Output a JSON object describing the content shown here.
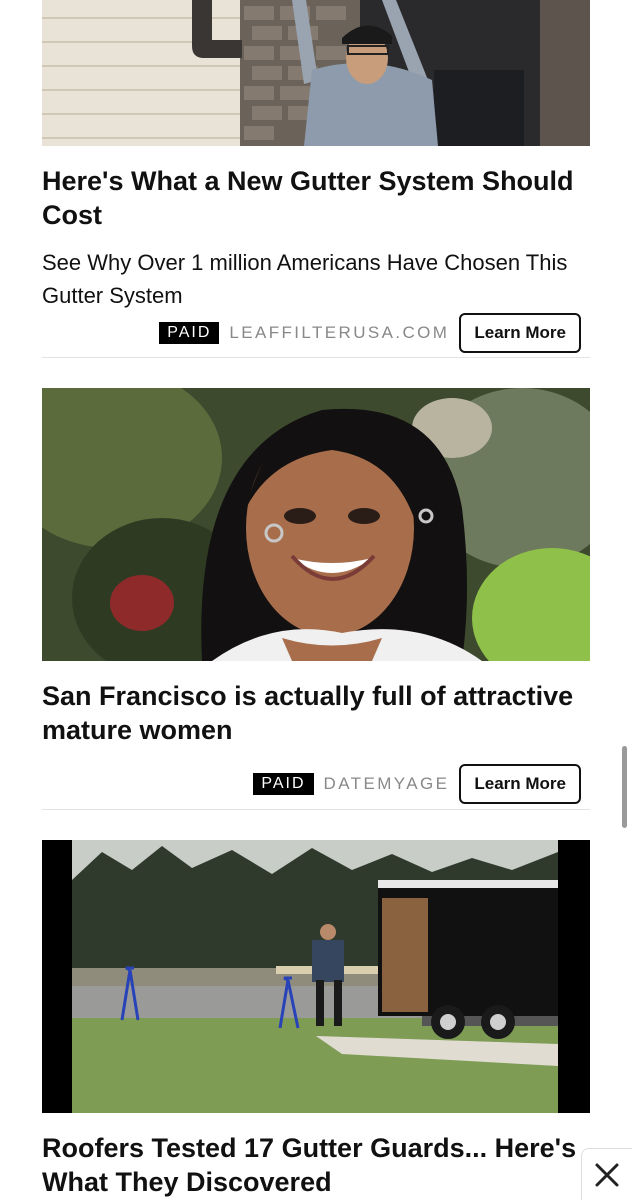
{
  "cards": [
    {
      "headline": "Here's What a New Gutter System Should Cost",
      "description": "See Why Over 1 million  Americans Have Chosen This Gutter System",
      "paid_label": "PAID",
      "sponsor": "LEAFFILTERUSA.COM",
      "cta_label": "Learn More"
    },
    {
      "headline": "San Francisco is actually full of attractive mature women",
      "paid_label": "PAID",
      "sponsor": "DATEMYAGE",
      "cta_label": "Learn More"
    },
    {
      "headline": "Roofers Tested 17 Gutter Guards... Here's What They Discovered"
    }
  ],
  "icons": {
    "close": "close-icon"
  },
  "colors": {
    "paid_badge_bg": "#000000",
    "sponsor_text": "#888888",
    "divider": "#e2e2e2"
  }
}
